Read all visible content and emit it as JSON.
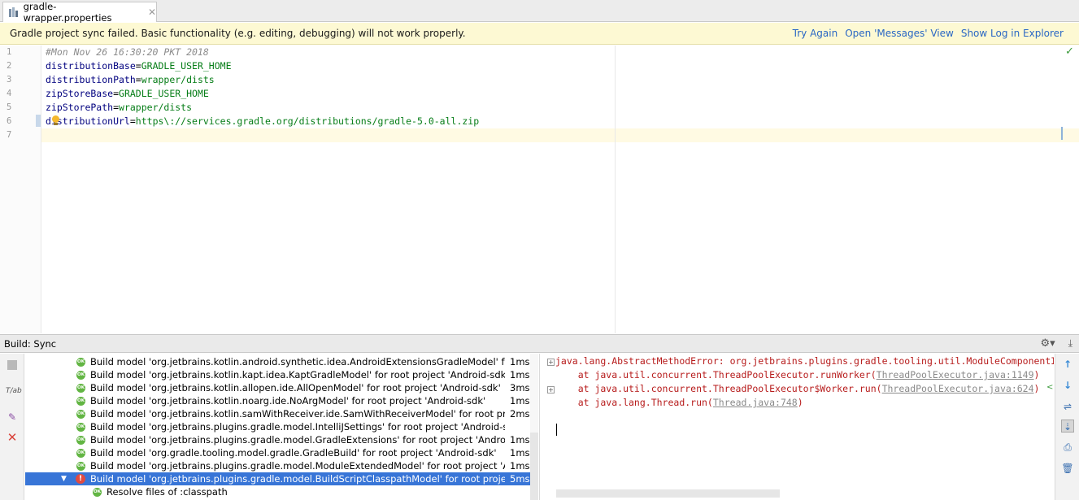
{
  "tab": {
    "file_name": "gradle-wrapper.properties",
    "close": "✕"
  },
  "banner": {
    "message": "Gradle project sync failed. Basic functionality (e.g. editing, debugging) will not work properly.",
    "links": [
      "Try Again",
      "Open 'Messages' View",
      "Show Log in Explorer"
    ]
  },
  "editor": {
    "line_numbers": [
      "1",
      "2",
      "3",
      "4",
      "5",
      "6",
      "7"
    ],
    "lines": [
      {
        "comment": "#Mon Nov 26 16:30:20 PKT 2018"
      },
      {
        "key": "distributionBase",
        "eq": "=",
        "value": "GRADLE_USER_HOME"
      },
      {
        "key": "distributionPath",
        "eq": "=",
        "value": "wrapper/dists"
      },
      {
        "key": "zipStoreBase",
        "eq": "=",
        "value": "GRADLE_USER_HOME"
      },
      {
        "key": "zipStorePath",
        "eq": "=",
        "value": "wrapper/dists"
      },
      {
        "key": "distributionUrl",
        "eq": "=",
        "value": "https\\://services.gradle.org/distributions/gradle-5.0-all.zip"
      },
      {
        "key": "",
        "eq": "",
        "value": ""
      }
    ]
  },
  "build": {
    "title": "Build: Sync",
    "tree": [
      {
        "label": "Build model 'org.jetbrains.kotlin.android.synthetic.idea.AndroidExtensionsGradleModel' for root project 'Android-sdk'",
        "time": "1ms",
        "status": "ok"
      },
      {
        "label": "Build model 'org.jetbrains.kotlin.kapt.idea.KaptGradleModel' for root project 'Android-sdk'",
        "time": "1ms",
        "status": "ok"
      },
      {
        "label": "Build model 'org.jetbrains.kotlin.allopen.ide.AllOpenModel' for root project 'Android-sdk'",
        "time": "3ms",
        "status": "ok"
      },
      {
        "label": "Build model 'org.jetbrains.kotlin.noarg.ide.NoArgModel' for root project 'Android-sdk'",
        "time": "1ms",
        "status": "ok"
      },
      {
        "label": "Build model 'org.jetbrains.kotlin.samWithReceiver.ide.SamWithReceiverModel' for root project 'Android-sdk'",
        "time": "2ms",
        "status": "ok"
      },
      {
        "label": "Build model 'org.jetbrains.plugins.gradle.model.IntelliJSettings' for root project 'Android-sdk'",
        "time": "",
        "status": "ok"
      },
      {
        "label": "Build model 'org.jetbrains.plugins.gradle.model.GradleExtensions' for root project 'Android-sdk'",
        "time": "1ms",
        "status": "ok"
      },
      {
        "label": "Build model 'org.gradle.tooling.model.gradle.GradleBuild' for root project 'Android-sdk'",
        "time": "1ms",
        "status": "ok"
      },
      {
        "label": "Build model 'org.jetbrains.plugins.gradle.model.ModuleExtendedModel' for root project 'Android-sdk'",
        "time": "1ms",
        "status": "ok"
      },
      {
        "label": "Build model 'org.jetbrains.plugins.gradle.model.BuildScriptClasspathModel' for root project 'Android-sdk'",
        "time": "5ms",
        "status": "error"
      },
      {
        "label": "Resolve files of :classpath",
        "time": "",
        "status": "ok"
      }
    ],
    "console": {
      "error_line": "java.lang.AbstractMethodError: org.jetbrains.plugins.gradle.tooling.util.ModuleComponentIdentifierImpl",
      "stack": [
        {
          "prefix": "    at java.util.concurrent.ThreadPoolExecutor.runWorker(",
          "link": "ThreadPoolExecutor.java:1149",
          "suffix": ")"
        },
        {
          "prefix": "    at java.util.concurrent.ThreadPoolExecutor$Worker.run(",
          "link": "ThreadPoolExecutor.java:624",
          "suffix": ")"
        },
        {
          "prefix": "    at java.lang.Thread.run(",
          "link": "Thread.java:748",
          "suffix": ")"
        }
      ]
    }
  }
}
